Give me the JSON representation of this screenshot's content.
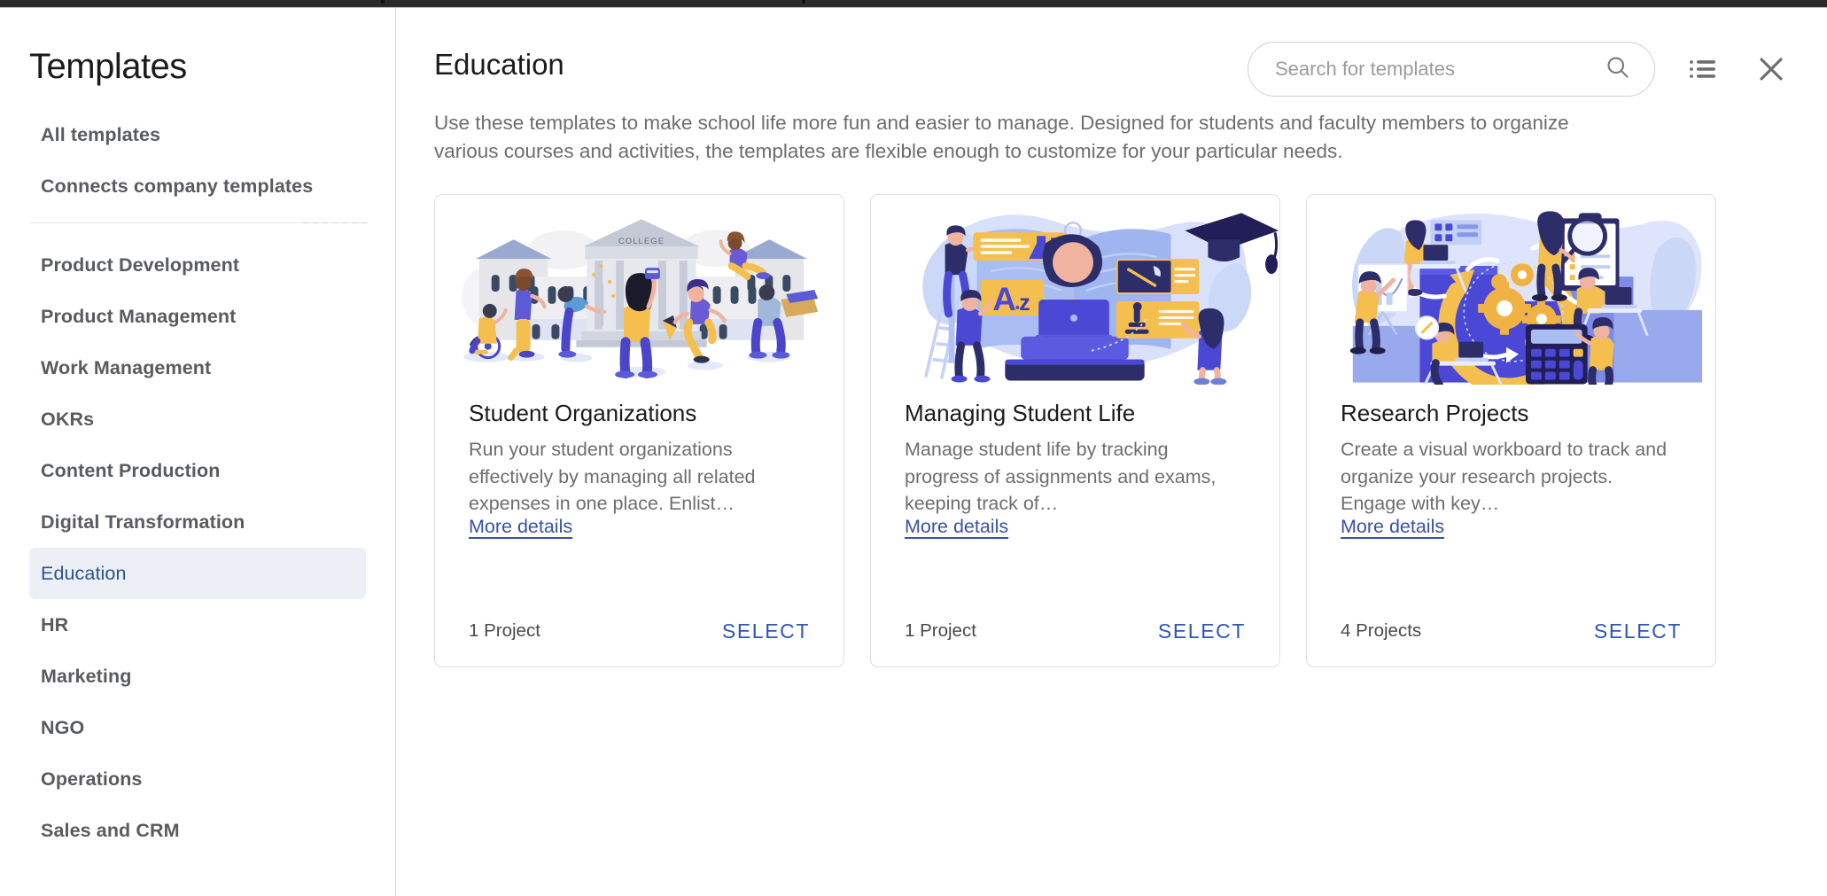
{
  "sidebar": {
    "title": "Templates",
    "top_items": [
      {
        "label": "All templates"
      },
      {
        "label": "Connects company templates"
      }
    ],
    "category_items": [
      {
        "label": "Product Development",
        "active": false
      },
      {
        "label": "Product Management",
        "active": false
      },
      {
        "label": "Work Management",
        "active": false
      },
      {
        "label": "OKRs",
        "active": false
      },
      {
        "label": "Content Production",
        "active": false
      },
      {
        "label": "Digital Transformation",
        "active": false
      },
      {
        "label": "Education",
        "active": true
      },
      {
        "label": "HR",
        "active": false
      },
      {
        "label": "Marketing",
        "active": false
      },
      {
        "label": "NGO",
        "active": false
      },
      {
        "label": "Operations",
        "active": false
      },
      {
        "label": "Sales and CRM",
        "active": false
      }
    ]
  },
  "header": {
    "page_title": "Education",
    "search_placeholder": "Search for templates",
    "search_value": "",
    "search_icon": "search-icon",
    "list_view_icon": "list-view-icon",
    "close_icon": "close-icon"
  },
  "main": {
    "description": "Use these templates to make school life more fun and easier to manage. Designed for students and faculty members to organize various courses and activities, the templates are flexible enough to customize for your particular needs."
  },
  "cards": [
    {
      "title": "Student Organizations",
      "description": "Run your student organizations effectively by managing all related expenses in one place. Enlist…",
      "more_details_label": "More details",
      "project_count_label": "1 Project",
      "select_label": "SELECT",
      "illustration": "college-campus-students-illustration",
      "illustration_text": "COLLEGE"
    },
    {
      "title": "Managing Student Life",
      "description": "Manage student life by tracking progress of assignments and exams, keeping track of…",
      "more_details_label": "More details",
      "project_count_label": "1 Project",
      "select_label": "SELECT",
      "illustration": "student-studying-book-illustration",
      "illustration_text": "A..z"
    },
    {
      "title": "Research Projects",
      "description": "Create a visual workboard to track and organize your research projects. Engage with key…",
      "more_details_label": "More details",
      "project_count_label": "4 Projects",
      "select_label": "SELECT",
      "illustration": "research-workflow-gears-illustration",
      "illustration_text": ""
    }
  ],
  "colors": {
    "accent_blue": "#2f55b5",
    "link_blue": "#3a51a8",
    "active_nav_bg": "#eceff5",
    "active_nav_text": "#2c5490",
    "text_muted": "#6d6d6d",
    "illu_yellow": "#f5bf4f",
    "illu_indigo": "#4a48d4",
    "illu_light_blue": "#c7d2f5"
  }
}
